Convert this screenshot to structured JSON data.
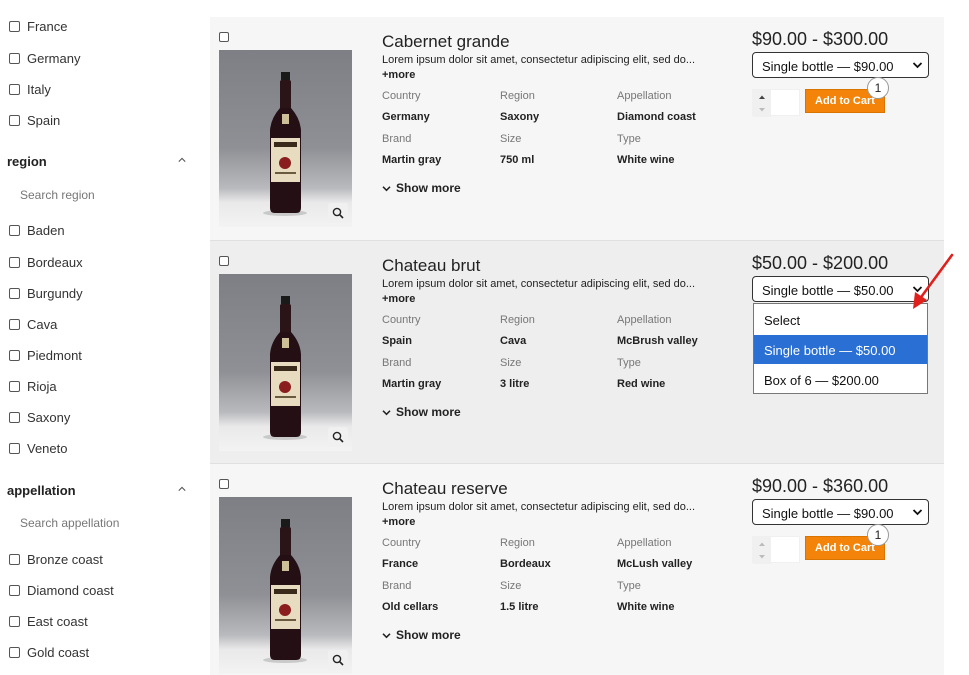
{
  "sidebar": {
    "country_items": [
      "France",
      "Germany",
      "Italy",
      "Spain"
    ],
    "region": {
      "title": "region",
      "search_placeholder": "Search region",
      "items": [
        "Baden",
        "Bordeaux",
        "Burgundy",
        "Cava",
        "Piedmont",
        "Rioja",
        "Saxony",
        "Veneto"
      ]
    },
    "appellation": {
      "title": "appellation",
      "search_placeholder": "Search appellation",
      "items": [
        "Bronze coast",
        "Diamond coast",
        "East coast",
        "Gold coast"
      ]
    }
  },
  "labels": {
    "country": "Country",
    "region": "Region",
    "appellation": "Appellation",
    "brand": "Brand",
    "size": "Size",
    "type": "Type",
    "more": "+more",
    "show_more": "Show more",
    "add_to_cart": "Add to Cart"
  },
  "products": [
    {
      "name": "Cabernet grande",
      "description": "Lorem ipsum dolor sit amet, consectetur adipiscing elit, sed do...",
      "country": "Germany",
      "region": "Saxony",
      "appellation": "Diamond coast",
      "brand": "Martin gray",
      "size": "750 ml",
      "type": "White wine",
      "price": "$90.00 - $300.00",
      "variant": "Single bottle — $90.00",
      "quantity_badge": "1"
    },
    {
      "name": "Chateau brut",
      "description": "Lorem ipsum dolor sit amet, consectetur adipiscing elit, sed do...",
      "country": "Spain",
      "region": "Cava",
      "appellation": "McBrush valley",
      "brand": "Martin gray",
      "size": "3 litre",
      "type": "Red wine",
      "price": "$50.00 - $200.00",
      "variant": "Single bottle — $50.00"
    },
    {
      "name": "Chateau reserve",
      "description": "Lorem ipsum dolor sit amet, consectetur adipiscing elit, sed do...",
      "country": "France",
      "region": "Bordeaux",
      "appellation": "McLush valley",
      "brand": "Old cellars",
      "size": "1.5 litre",
      "type": "White wine",
      "price": "$90.00 - $360.00",
      "variant": "Single bottle — $90.00",
      "quantity_badge": "1"
    }
  ],
  "dropdown": {
    "options": [
      "Select",
      "Single bottle — $50.00",
      "Box of 6 — $200.00"
    ],
    "selected_index": 1
  },
  "colors": {
    "accent_button": "#f38409",
    "dropdown_highlight": "#2a6fd3",
    "annotation_arrow": "#e0201c"
  },
  "icons": {
    "zoom": "magnifier-icon",
    "show_more": "chevron-down-icon",
    "collapse": "chevron-up-icon",
    "annotation": "red-arrow-icon"
  }
}
